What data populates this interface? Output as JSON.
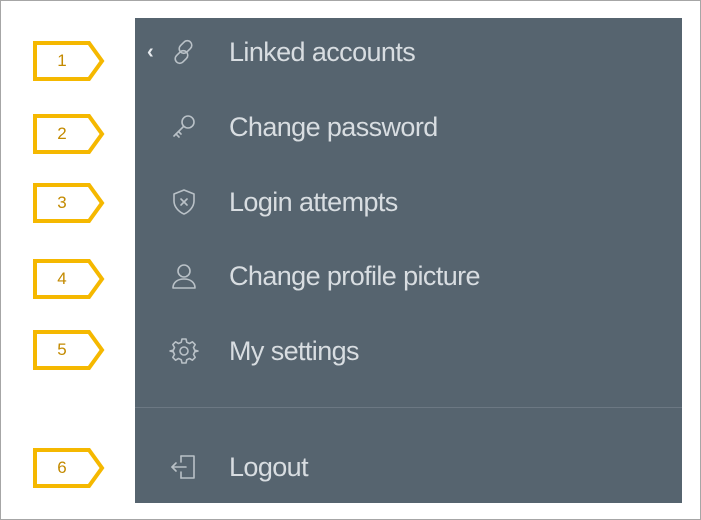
{
  "menu": {
    "items": [
      {
        "label": "Linked accounts",
        "icon": "link-icon"
      },
      {
        "label": "Change password",
        "icon": "key-icon"
      },
      {
        "label": "Login attempts",
        "icon": "shield-x-icon"
      },
      {
        "label": "Change profile picture",
        "icon": "user-icon"
      },
      {
        "label": "My settings",
        "icon": "gear-icon"
      },
      {
        "label": "Logout",
        "icon": "logout-icon"
      }
    ],
    "back_icon": "chevron-left-icon"
  },
  "callouts": [
    "1",
    "2",
    "3",
    "4",
    "5",
    "6"
  ],
  "colors": {
    "panel_bg": "#56646f",
    "label_text": "#d8dde1",
    "icon_stroke": "#b9c1c7",
    "callout_border": "#f5b800",
    "callout_text": "#c38a00"
  }
}
